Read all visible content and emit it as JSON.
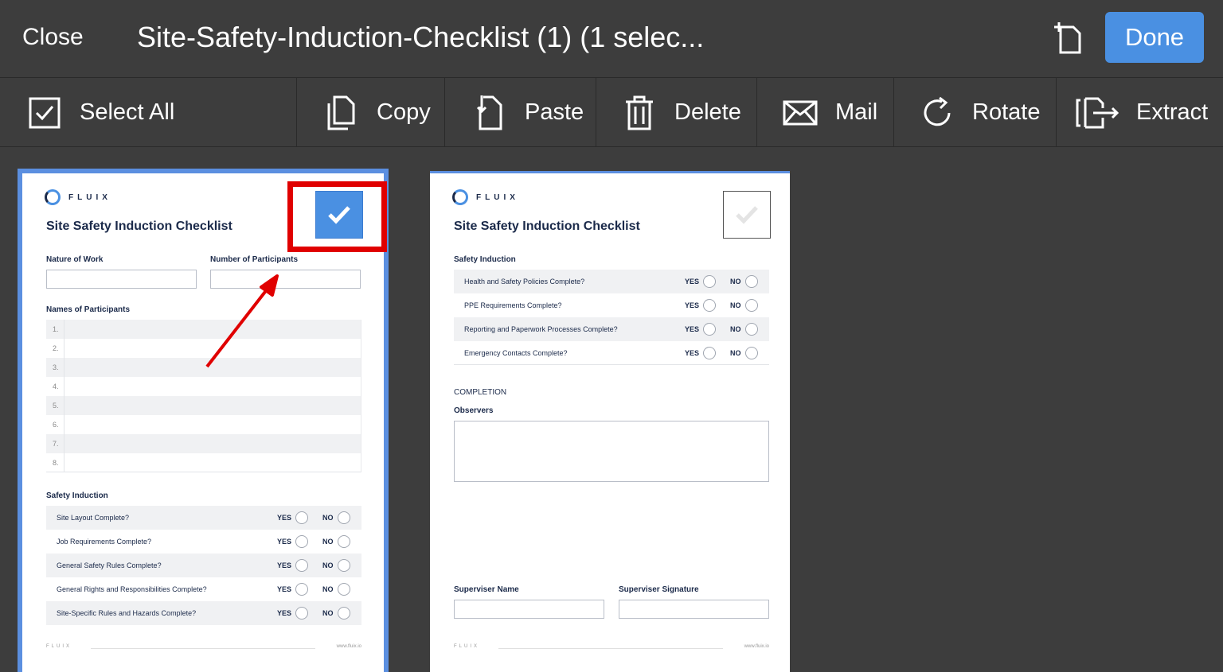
{
  "header": {
    "close_label": "Close",
    "title": "Site-Safety-Induction-Checklist (1) (1 selec...",
    "done_label": "Done"
  },
  "toolbar": {
    "items": [
      {
        "label": "Select All",
        "icon": "checkbox-icon"
      },
      {
        "label": "Copy",
        "icon": "copy-icon"
      },
      {
        "label": "Paste",
        "icon": "paste-icon"
      },
      {
        "label": "Delete",
        "icon": "trash-icon"
      },
      {
        "label": "Mail",
        "icon": "mail-icon"
      },
      {
        "label": "Rotate",
        "icon": "rotate-icon"
      },
      {
        "label": "Extract",
        "icon": "extract-icon"
      }
    ]
  },
  "pages": [
    {
      "selected": true,
      "brand": "FLUIX",
      "title": "Site Safety Induction Checklist",
      "nature_label": "Nature of Work",
      "participants_label": "Number of Participants",
      "names_label": "Names of Participants",
      "names": [
        "1.",
        "2.",
        "3.",
        "4.",
        "5.",
        "6.",
        "7.",
        "8."
      ],
      "section_label": "Safety Induction",
      "questions": [
        "Site Layout Complete?",
        "Job Requirements Complete?",
        "General Safety Rules Complete?",
        "General Rights and Responsibilities Complete?",
        "Site-Specific Rules and Hazards Complete?"
      ],
      "yes": "YES",
      "no": "NO",
      "footer_brand": "FLUIX",
      "footer_url": "www.fluix.io"
    },
    {
      "selected": false,
      "brand": "FLUIX",
      "title": "Site Safety Induction Checklist",
      "section_label": "Safety Induction",
      "questions": [
        "Health and Safety Policies Complete?",
        "PPE Requirements Complete?",
        "Reporting and Paperwork Processes Complete?",
        "Emergency Contacts Complete?"
      ],
      "yes": "YES",
      "no": "NO",
      "completion_label": "COMPLETION",
      "observers_label": "Observers",
      "supervisor_name_label": "Superviser Name",
      "supervisor_sig_label": "Superviser Signature",
      "footer_brand": "FLUIX",
      "footer_url": "www.fluix.io"
    }
  ],
  "colors": {
    "accent": "#4a90e2",
    "background": "#3d3d3d",
    "highlight": "#e00000"
  }
}
